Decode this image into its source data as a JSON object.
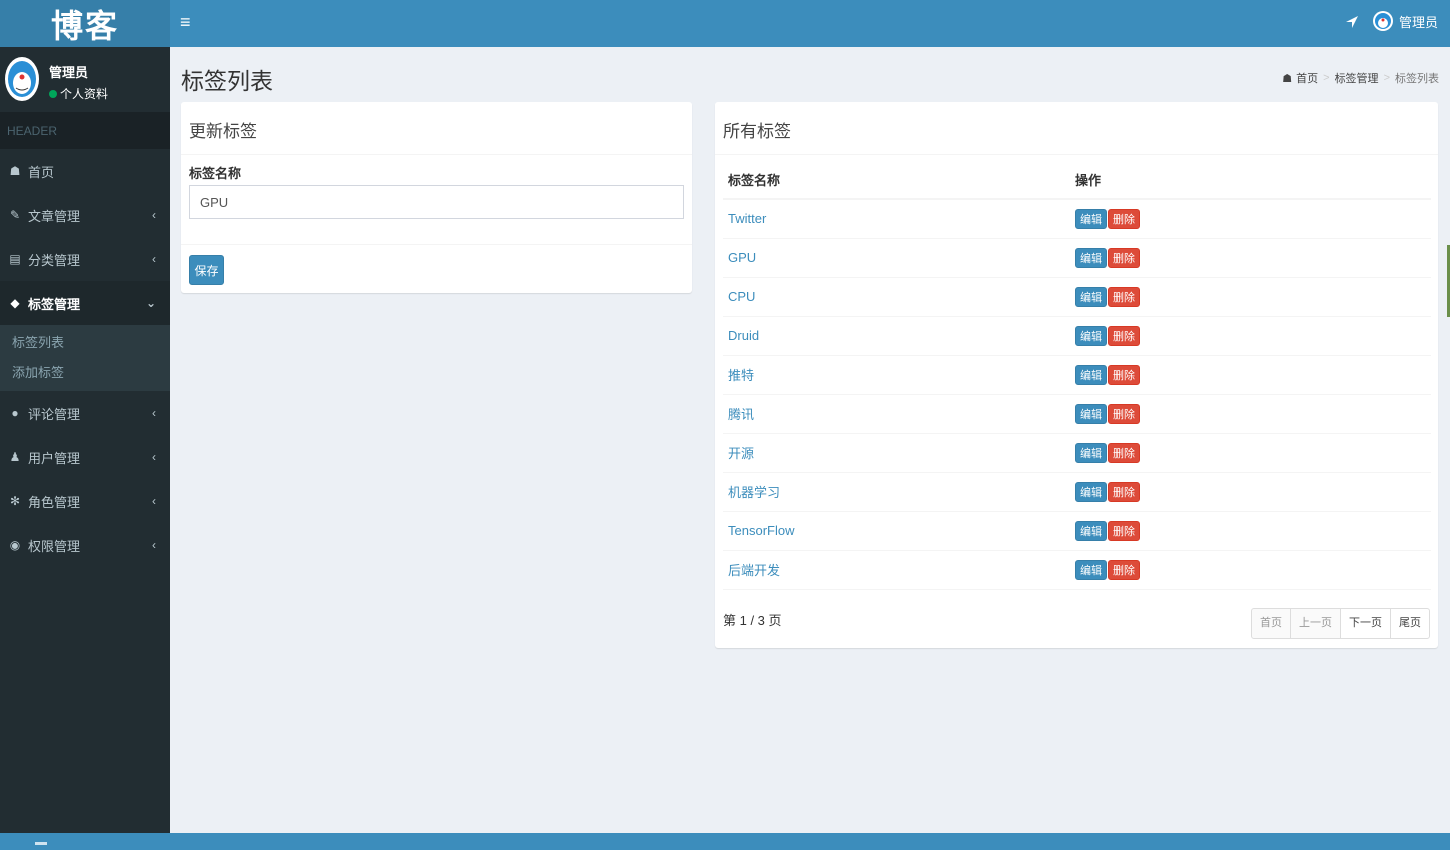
{
  "brand": {
    "logo_text": "博客"
  },
  "header": {
    "toggle_icon": "≡",
    "user_name": "管理员"
  },
  "sidebar": {
    "user": {
      "name": "管理员",
      "status": "个人资料"
    },
    "section_header": "HEADER",
    "menu": [
      {
        "label": "首页",
        "icon": "dashboard-icon",
        "glyph": "☗"
      },
      {
        "label": "文章管理",
        "icon": "pencil-icon",
        "glyph": "✎",
        "caret": "‹"
      },
      {
        "label": "分类管理",
        "icon": "book-icon",
        "glyph": "▤",
        "caret": "‹"
      },
      {
        "label": "标签管理",
        "icon": "tag-icon",
        "glyph": "◆",
        "caret": "⌄"
      },
      {
        "label": "评论管理",
        "icon": "comment-icon",
        "glyph": "●",
        "caret": "‹"
      },
      {
        "label": "用户管理",
        "icon": "user-icon",
        "glyph": "♟",
        "caret": "‹"
      },
      {
        "label": "角色管理",
        "icon": "snowflake-icon",
        "glyph": "✻",
        "caret": "‹"
      },
      {
        "label": "权限管理",
        "icon": "location-icon",
        "glyph": "◉",
        "caret": "‹"
      }
    ],
    "submenu": [
      "标签列表",
      "添加标签"
    ]
  },
  "page": {
    "title": "标签列表"
  },
  "breadcrumb": {
    "home": "首页",
    "parent": "标签管理",
    "current": "标签列表",
    "separator": ">"
  },
  "form_box": {
    "title": "更新标签",
    "field_label": "标签名称",
    "field_value": "GPU",
    "save_label": "保存"
  },
  "list_box": {
    "title": "所有标签",
    "columns": [
      "标签名称",
      "操作"
    ],
    "rows": [
      "Twitter",
      "GPU",
      "CPU",
      "Druid",
      "推特",
      "腾讯",
      "开源",
      "机器学习",
      "TensorFlow",
      "后端开发"
    ],
    "edit_label": "编辑",
    "delete_label": "删除",
    "page_info": "第 1 / 3 页",
    "pager": {
      "first": "首页",
      "prev": "上一页",
      "next": "下一页",
      "last": "尾页"
    }
  },
  "colors": {
    "primary": "#3c8dbc",
    "danger": "#dd4b39",
    "sidebar": "#222d32",
    "online": "#00a65a"
  }
}
